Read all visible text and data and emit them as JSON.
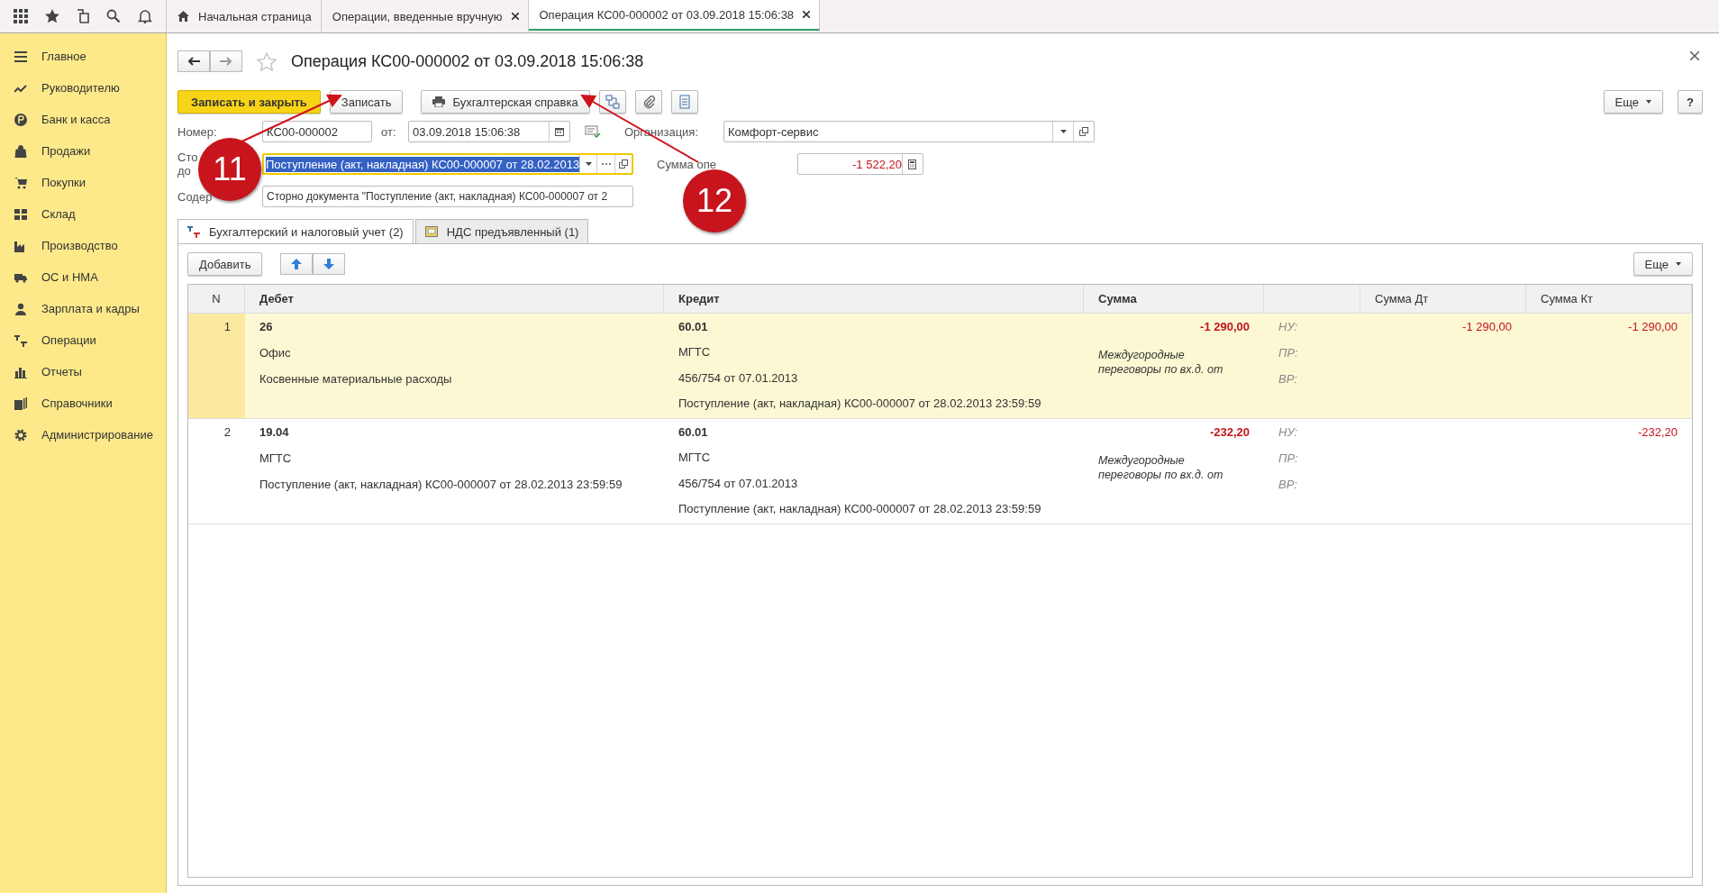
{
  "sidebar": {
    "items": [
      {
        "label": "Главное"
      },
      {
        "label": "Руководителю"
      },
      {
        "label": "Банк и касса"
      },
      {
        "label": "Продажи"
      },
      {
        "label": "Покупки"
      },
      {
        "label": "Склад"
      },
      {
        "label": "Производство"
      },
      {
        "label": "ОС и НМА"
      },
      {
        "label": "Зарплата и кадры"
      },
      {
        "label": "Операции"
      },
      {
        "label": "Отчеты"
      },
      {
        "label": "Справочники"
      },
      {
        "label": "Администрирование"
      }
    ]
  },
  "tabs": [
    {
      "label": "Начальная страница",
      "selected": false
    },
    {
      "label": "Операции, введенные вручную",
      "selected": false
    },
    {
      "label": "Операция КС00-000002 от 03.09.2018 15:06:38",
      "selected": true
    }
  ],
  "form": {
    "title": "Операция КС00-000002 от 03.09.2018 15:06:38",
    "buttons": {
      "save_close": "Записать и закрыть",
      "save": "Записать",
      "report": "Бухгалтерская справка",
      "more": "Еще",
      "help": "?"
    },
    "number": {
      "label": "Номер:",
      "value": "КС00-000002"
    },
    "date": {
      "label": "от:",
      "value": "03.09.2018 15:06:38"
    },
    "organization": {
      "label": "Организация:",
      "value": "Комфорт-сервис"
    },
    "document": {
      "label_lines": [
        "Сто",
        "до"
      ],
      "value": "Поступление (акт, накладная) КС00-000007 от 28.02.2013"
    },
    "amount": {
      "label": "Сумма опе",
      "value": "-1 522,20"
    },
    "content": {
      "label": "Содер",
      "value": "Сторно документа \"Поступление (акт, накладная) КС00-000007 от 2"
    }
  },
  "subtabs": [
    {
      "label": "Бухгалтерский и налоговый учет (2)",
      "selected": true
    },
    {
      "label": "НДС предъявленный (1)",
      "selected": false
    }
  ],
  "table": {
    "add": "Добавить",
    "more": "Еще",
    "columns": [
      "N",
      "Дебет",
      "Кредит",
      "Сумма",
      "Сумма Дт",
      "Сумма Кт"
    ],
    "rows": [
      {
        "n": "1",
        "selected": true,
        "debit": [
          "26",
          "Офис",
          "Косвенные материальные расходы"
        ],
        "credit": [
          "60.01",
          "МГТС",
          "456/754 от 07.01.2013",
          "Поступление (акт, накладная) КС00-000007 от 28.02.2013 23:59:59"
        ],
        "sum": "-1 290,00",
        "comment": "Междугородные переговоры по вх.д.  от",
        "tax": [
          {
            "label": "НУ:",
            "dt": "-1 290,00",
            "kt": "-1 290,00"
          },
          {
            "label": "ПР:"
          },
          {
            "label": "ВР:"
          }
        ]
      },
      {
        "n": "2",
        "selected": false,
        "debit": [
          "19.04",
          "МГТС",
          "Поступление (акт, накладная) КС00-000007 от 28.02.2013 23:59:59"
        ],
        "credit": [
          "60.01",
          "МГТС",
          "456/754 от 07.01.2013",
          "Поступление (акт, накладная) КС00-000007 от 28.02.2013 23:59:59"
        ],
        "sum": "-232,20",
        "comment": "Междугородные переговоры по вх.д.  от",
        "tax": [
          {
            "label": "НУ:",
            "kt": "-232,20"
          },
          {
            "label": "ПР:"
          },
          {
            "label": "ВР:"
          }
        ]
      }
    ]
  },
  "annotations": [
    {
      "number": "11"
    },
    {
      "number": "12"
    }
  ]
}
